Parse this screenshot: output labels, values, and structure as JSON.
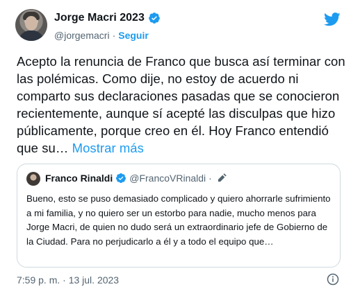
{
  "author": {
    "display_name": "Jorge Macri 2023",
    "handle": "@jorgemacri",
    "separator": "·",
    "follow_label": "Seguir"
  },
  "tweet": {
    "text": "Acepto la renuncia de Franco que busca así terminar con las polémicas. Como dije, no estoy de acuerdo ni comparto sus declaraciones pasadas que se conocieron recientemente, aunque sí acepté las disculpas que hizo públicamente, porque creo en él. Hoy Franco entendió que su…",
    "show_more_label": "Mostrar más"
  },
  "quoted_tweet": {
    "display_name": "Franco Rinaldi",
    "handle": "@FrancoVRinaldi",
    "separator": "·",
    "text": "Bueno, esto se puso demasiado complicado y quiero ahorrarle sufrimiento a mi familia, y no quiero ser un estorbo para nadie, mucho menos para Jorge Macri, de quien no dudo será un extraordinario jefe de Gobierno de la Ciudad. Para no perjudicarlo a él y a todo el equipo que…"
  },
  "footer": {
    "timestamp": "7:59 p. m. · 13 jul. 2023"
  },
  "colors": {
    "accent": "#1d9bf0",
    "text": "#0f1419",
    "secondary": "#536471",
    "border": "#cfd9de"
  },
  "icons": [
    "verified-badge-icon",
    "twitter-bird-icon",
    "edit-pencil-icon",
    "info-icon"
  ]
}
